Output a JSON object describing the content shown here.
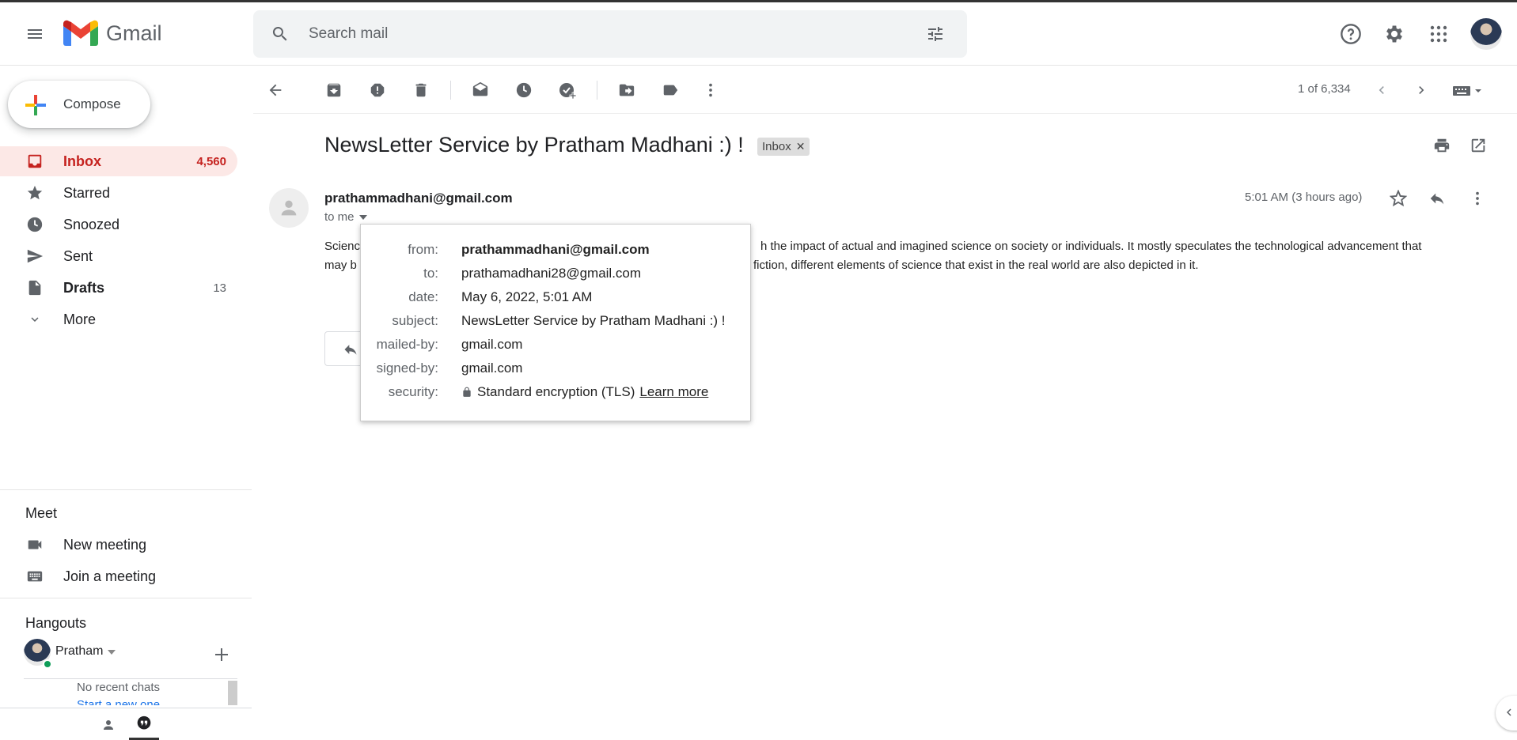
{
  "app": {
    "name": "Gmail"
  },
  "search": {
    "placeholder": "Search mail"
  },
  "sidebar": {
    "compose_label": "Compose",
    "items": [
      {
        "label": "Inbox",
        "count": "4,560"
      },
      {
        "label": "Starred",
        "count": ""
      },
      {
        "label": "Snoozed",
        "count": ""
      },
      {
        "label": "Sent",
        "count": ""
      },
      {
        "label": "Drafts",
        "count": "13"
      },
      {
        "label": "More",
        "count": ""
      }
    ],
    "meet": {
      "title": "Meet",
      "new_meeting": "New meeting",
      "join_meeting": "Join a meeting"
    },
    "hangouts": {
      "title": "Hangouts",
      "user_name": "Pratham",
      "no_recent": "No recent chats",
      "start_new": "Start a new one"
    }
  },
  "toolbar": {
    "pager": "1 of 6,334"
  },
  "email": {
    "subject": "NewsLetter Service by Pratham Madhani :) !",
    "label": "Inbox",
    "sender": "prathammadhani@gmail.com",
    "to_me": "to me",
    "time": "5:01 AM (3 hours ago)",
    "body_line1_start": "Scienc",
    "body_line1_end": "h the impact of actual and imagined science on society or individuals. It mostly speculates the technological advancement that",
    "body_line2_start": "may b",
    "body_line2_end": "fiction, different elements of science that exist in the real world are also depicted in it."
  },
  "details": {
    "from_key": "from:",
    "from_val": "prathammadhani@gmail.com",
    "to_key": "to:",
    "to_val": "prathamadhani28@gmail.com",
    "date_key": "date:",
    "date_val": "May 6, 2022, 5:01 AM",
    "subject_key": "subject:",
    "subject_val": "NewsLetter Service by Pratham Madhani :) !",
    "mailed_key": "mailed-by:",
    "mailed_val": "gmail.com",
    "signed_key": "signed-by:",
    "signed_val": "gmail.com",
    "security_key": "security:",
    "security_val": "Standard encryption (TLS)",
    "learn_more": "Learn more"
  },
  "colors": {
    "accent_red": "#c5221f",
    "active_bg": "#fce8e6",
    "icon_gray": "#5f6368"
  }
}
